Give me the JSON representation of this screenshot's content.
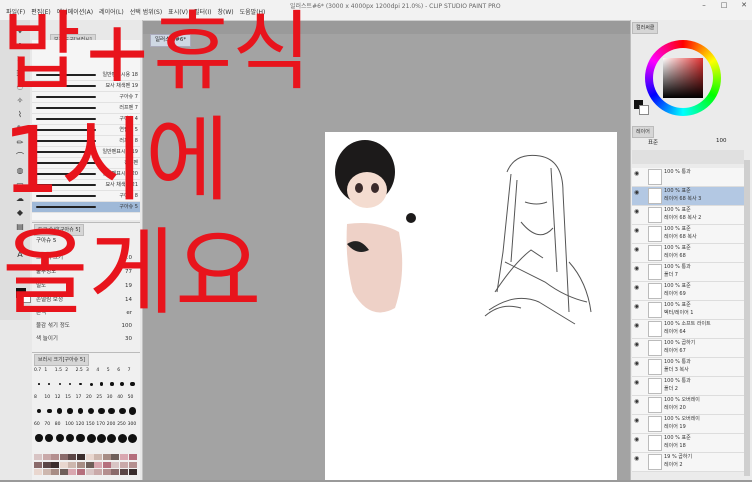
{
  "title_bar": {
    "title": "일러스트#6* (3000 x 4000px 1200dpi 21.0%) - CLIP STUDIO PAINT PRO",
    "menus": [
      "파일(F)",
      "편집(E)",
      "애니메이션(A)",
      "레이어(L)",
      "선택 범위(S)",
      "표시(V)",
      "필터(I)",
      "창(W)",
      "도움말(H)"
    ]
  },
  "overlay": {
    "line1": "밥+휴식",
    "line2": "1시에",
    "line3": "올게요",
    "color": "#e8141c"
  },
  "document_tab": "일러스트#6*",
  "brush_panel": {
    "tab_label": "보조 도구[브러시]",
    "top_tabs": [
      "격리",
      "격리",
      "격리"
    ],
    "items": [
      {
        "label": "일반펜표시용 18"
      },
      {
        "label": "묘사 채색펜 19"
      },
      {
        "label": "구아슈 7"
      },
      {
        "label": "러프펜 7"
      },
      {
        "label": "구아슈 4"
      },
      {
        "label": "연필펜 5"
      },
      {
        "label": "러프펜 8"
      },
      {
        "label": "일반펜표시용 19"
      },
      {
        "label": "창작펜"
      },
      {
        "label": "일반펜표시용 20"
      },
      {
        "label": "묘사 채색펜 21"
      },
      {
        "label": "구아슈 8"
      },
      {
        "label": "구아슈 5"
      }
    ],
    "selected_index": 12
  },
  "tool_property": {
    "tab_label": "도구 속성[구아슈 5]",
    "header": "구아슈 5",
    "rows": [
      {
        "label": "브러시 크기",
        "value": "5.0"
      },
      {
        "label": "불투명도",
        "value": "77"
      },
      {
        "label": "밀도",
        "value": "19"
      },
      {
        "label": "손떨림 보정",
        "value": "14"
      },
      {
        "label": "혼색",
        "value": "er"
      },
      {
        "label": "물감 섞기 정도",
        "value": "100"
      },
      {
        "label": "색 늘이기",
        "value": "30"
      }
    ]
  },
  "brush_size_panel": {
    "tab_label": "브러시 크기[구아슈 5]",
    "sizes": [
      "0.7",
      "1",
      "1.5",
      "2",
      "2.5",
      "3",
      "4",
      "5",
      "6",
      "7",
      "8",
      "10",
      "12",
      "15",
      "17",
      "20",
      "25",
      "30",
      "40",
      "50",
      "60",
      "70",
      "80",
      "100",
      "120",
      "150",
      "170",
      "200",
      "250",
      "300"
    ]
  },
  "color_panel": {
    "tab_label": "컬러써클",
    "main_color": "#111111",
    "sub_color": "#ffffff"
  },
  "layer_panel": {
    "tab_label": "레이어",
    "blend_mode": "표준",
    "opacity": "100",
    "layers": [
      {
        "line1": "100 % 통과",
        "line2": ""
      },
      {
        "line1": "100 % 표준",
        "line2": "레이어 68 복사 3"
      },
      {
        "line1": "100 % 표준",
        "line2": "레이어 68 복사 2"
      },
      {
        "line1": "100 % 표준",
        "line2": "레이어 68 복사"
      },
      {
        "line1": "100 % 표준",
        "line2": "레이어 68"
      },
      {
        "line1": "100 % 통과",
        "line2": "폴더 7"
      },
      {
        "line1": "100 % 표준",
        "line2": "레이어 69"
      },
      {
        "line1": "100 % 표준",
        "line2": "벡터/레이어 1"
      },
      {
        "line1": "100 % 소프트 라이트",
        "line2": "레이어 64"
      },
      {
        "line1": "100 % 곱하기",
        "line2": "레이어 67"
      },
      {
        "line1": "100 % 통과",
        "line2": "폴더 3 복사"
      },
      {
        "line1": "100 % 통과",
        "line2": "폴더 2"
      },
      {
        "line1": "100 % 오버레이",
        "line2": "레이어 20"
      },
      {
        "line1": "100 % 오버레이",
        "line2": "레이어 19"
      },
      {
        "line1": "100 % 표준",
        "line2": "레이어 18"
      },
      {
        "line1": "19 % 곱하기",
        "line2": "레이어 2"
      }
    ],
    "selected_index": 1
  }
}
